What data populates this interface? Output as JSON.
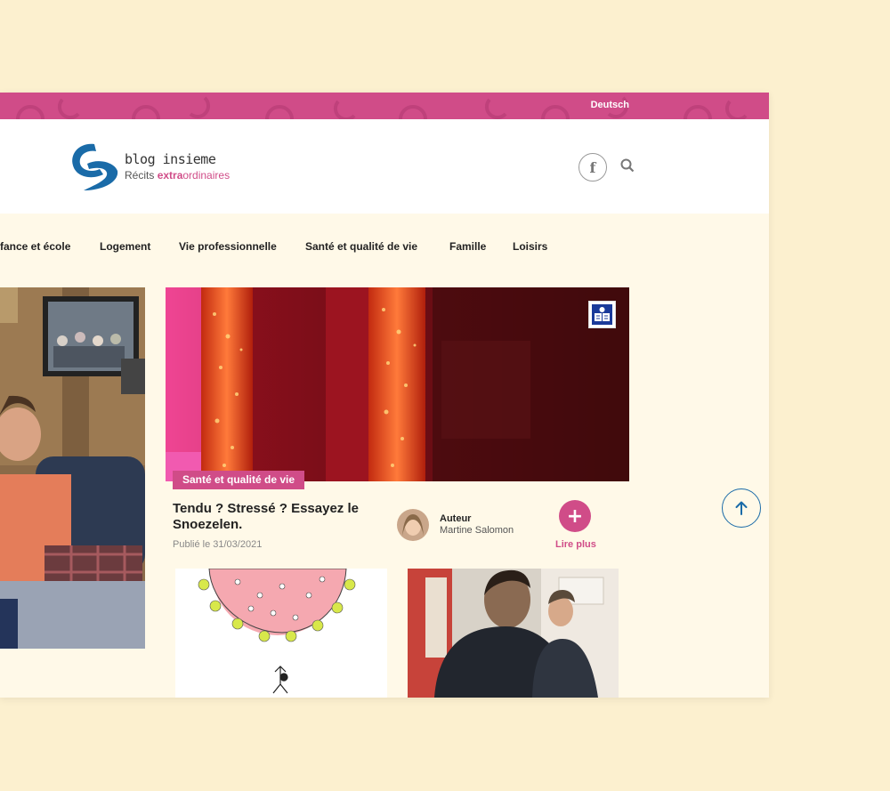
{
  "topbar": {
    "language_link": "Deutsch"
  },
  "header": {
    "logo_line1": "blog insieme",
    "logo_line2_pre": "Récits ",
    "logo_line2_bold": "extra",
    "logo_line2_post": "ordinaires",
    "facebook_glyph": "f"
  },
  "nav": {
    "items": [
      {
        "label": "fance et école"
      },
      {
        "label": "Logement"
      },
      {
        "label": "Vie professionnelle"
      },
      {
        "label": "Santé et qualité de vie"
      },
      {
        "label": "Famille"
      },
      {
        "label": "Loisirs"
      }
    ]
  },
  "article": {
    "category": "Santé et qualité de vie",
    "title": "Tendu ? Stressé ? Essayez le Snoezelen.",
    "date": "Publié le 31/03/2021",
    "author_label": "Auteur",
    "author_name": "Martine Salomon",
    "read_more": "Lire plus",
    "plus_glyph": "+"
  },
  "colors": {
    "accent": "#d04c88",
    "page_bg": "#fcf0cf",
    "content_bg": "#fff9e8",
    "link_blue": "#1a6ba8"
  },
  "icons": [
    "facebook-icon",
    "search-icon",
    "easy-read-icon",
    "plus-icon",
    "arrow-up-icon"
  ]
}
